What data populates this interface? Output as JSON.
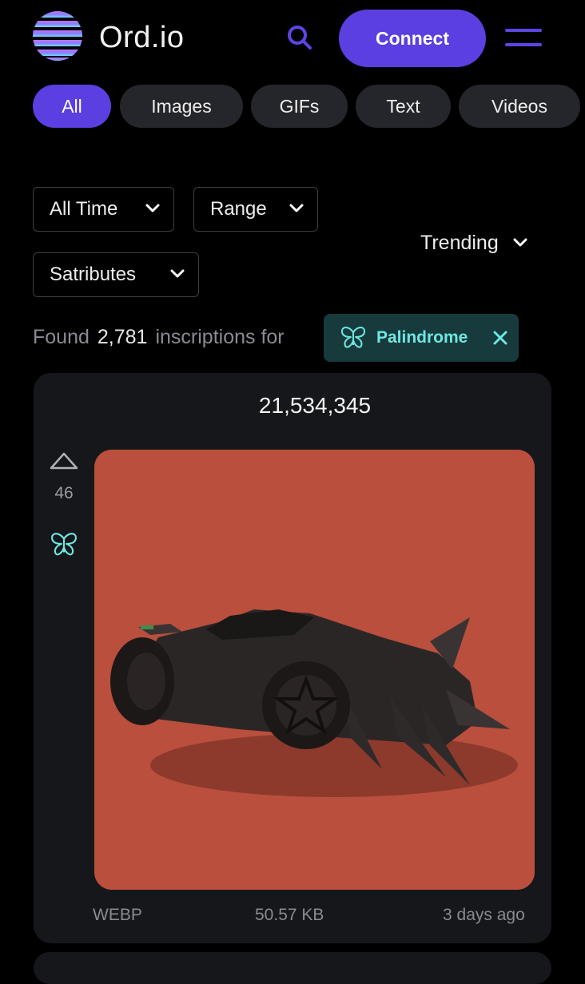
{
  "header": {
    "logo_text": "Ord.io",
    "connect_label": "Connect",
    "accent": "#5b3fe0"
  },
  "filters": {
    "pills": [
      {
        "label": "All",
        "active": true
      },
      {
        "label": "Images",
        "active": false
      },
      {
        "label": "GIFs",
        "active": false
      },
      {
        "label": "Text",
        "active": false
      },
      {
        "label": "Videos",
        "active": false
      }
    ],
    "time": "All Time",
    "range": "Range",
    "satributes": "Satributes",
    "sort": "Trending"
  },
  "results": {
    "found_label": "Found",
    "count": "2,781",
    "suffix": "inscriptions for",
    "tag": {
      "label": "Palindrome",
      "icon": "butterfly-icon",
      "color": "#6ee7e2"
    }
  },
  "card": {
    "number": "21,534,345",
    "votes": "46",
    "sat_icon": "butterfly-icon",
    "image_bg": "#b94f3c",
    "format": "WEBP",
    "size": "50.57 KB",
    "age": "3 days ago"
  }
}
